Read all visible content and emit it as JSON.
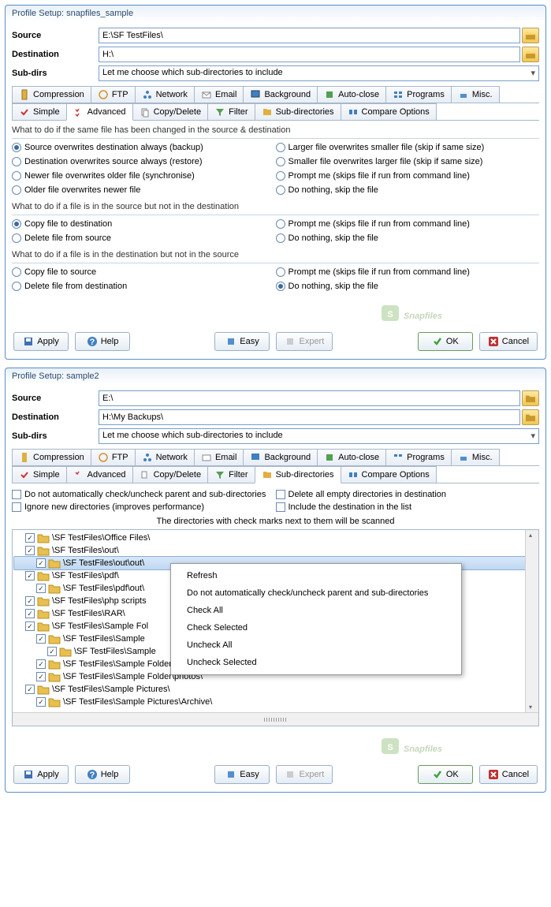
{
  "win1": {
    "title": "Profile Setup: snapfiles_sample",
    "source_label": "Source",
    "source_value": "E:\\SF TestFiles\\",
    "dest_label": "Destination",
    "dest_value": "H:\\",
    "subdirs_label": "Sub-dirs",
    "subdirs_value": "Let me choose which sub-directories to include",
    "tabs1": [
      "Compression",
      "FTP",
      "Network",
      "Email",
      "Background",
      "Auto-close",
      "Programs",
      "Misc."
    ],
    "tabs2": [
      "Simple",
      "Advanced",
      "Copy/Delete",
      "Filter",
      "Sub-directories",
      "Compare Options"
    ],
    "active_tab": "Advanced",
    "sec1": "What to do if the same file has been changed in the source & destination",
    "r1": [
      "Source overwrites destination always (backup)",
      "Destination overwrites source always (restore)",
      "Newer file overwrites older file (synchronise)",
      "Older file overwrites newer file"
    ],
    "r1b": [
      "Larger file overwrites smaller file (skip if same size)",
      "Smaller file overwrites larger file (skip if same size)",
      "Prompt me (skips file if run from command line)",
      "Do nothing, skip the file"
    ],
    "sec2": "What to do if a file is in the source but not in the destination",
    "r2": [
      "Copy file to destination",
      "Delete file from source"
    ],
    "r2b": [
      "Prompt me  (skips file if run from command line)",
      "Do nothing, skip the file"
    ],
    "sec3": "What to do if a file is in the destination but not in the source",
    "r3": [
      "Copy file to source",
      "Delete file from destination"
    ],
    "r3b": [
      "Prompt me  (skips file if run from command line)",
      "Do nothing, skip the file"
    ],
    "btns": {
      "apply": "Apply",
      "help": "Help",
      "easy": "Easy",
      "expert": "Expert",
      "ok": "OK",
      "cancel": "Cancel"
    }
  },
  "win2": {
    "title": "Profile Setup: sample2",
    "source_label": "Source",
    "source_value": "E:\\",
    "dest_label": "Destination",
    "dest_value": "H:\\My Backups\\",
    "subdirs_label": "Sub-dirs",
    "subdirs_value": "Let me choose which sub-directories to include",
    "tabs1": [
      "Compression",
      "FTP",
      "Network",
      "Email",
      "Background",
      "Auto-close",
      "Programs",
      "Misc."
    ],
    "tabs2": [
      "Simple",
      "Advanced",
      "Copy/Delete",
      "Filter",
      "Sub-directories",
      "Compare Options"
    ],
    "active_tab": "Sub-directories",
    "cb": {
      "c1": "Do not automatically check/uncheck parent and sub-directories",
      "c2": "Delete all empty directories in destination",
      "c3": "Ignore new directories (improves performance)",
      "c4": "Include the destination in the list"
    },
    "instruction": "The directories with check marks next to them will be scanned",
    "tree": [
      {
        "indent": 0,
        "label": "\\SF TestFiles\\Office Files\\",
        "checked": true
      },
      {
        "indent": 0,
        "label": "\\SF TestFiles\\out\\",
        "checked": true
      },
      {
        "indent": 1,
        "label": "\\SF TestFiles\\out\\out\\",
        "checked": true,
        "selected": true
      },
      {
        "indent": 0,
        "label": "\\SF TestFiles\\pdf\\",
        "checked": true
      },
      {
        "indent": 1,
        "label": "\\SF TestFiles\\pdf\\out\\",
        "checked": true
      },
      {
        "indent": 0,
        "label": "\\SF TestFiles\\php scripts",
        "checked": true
      },
      {
        "indent": 0,
        "label": "\\SF TestFiles\\RAR\\",
        "checked": true
      },
      {
        "indent": 0,
        "label": "\\SF TestFiles\\Sample Fol",
        "checked": true
      },
      {
        "indent": 1,
        "label": "\\SF TestFiles\\Sample",
        "checked": true
      },
      {
        "indent": 2,
        "label": "\\SF TestFiles\\Sample",
        "checked": true
      },
      {
        "indent": 1,
        "label": "\\SF TestFiles\\Sample Folder\\photos\\",
        "checked": true
      },
      {
        "indent": 1,
        "label": "\\SF TestFiles\\Sample Folder\\photos\\",
        "checked": true
      },
      {
        "indent": 0,
        "label": "\\SF TestFiles\\Sample Pictures\\",
        "checked": true
      },
      {
        "indent": 1,
        "label": "\\SF TestFiles\\Sample Pictures\\Archive\\",
        "checked": true
      }
    ],
    "ctx": [
      "Refresh",
      "Do not automatically check/uncheck parent and sub-directories",
      "Check All",
      "Check Selected",
      "Uncheck All",
      "Uncheck Selected"
    ],
    "btns": {
      "apply": "Apply",
      "help": "Help",
      "easy": "Easy",
      "expert": "Expert",
      "ok": "OK",
      "cancel": "Cancel"
    }
  },
  "watermark": "Snapfiles"
}
